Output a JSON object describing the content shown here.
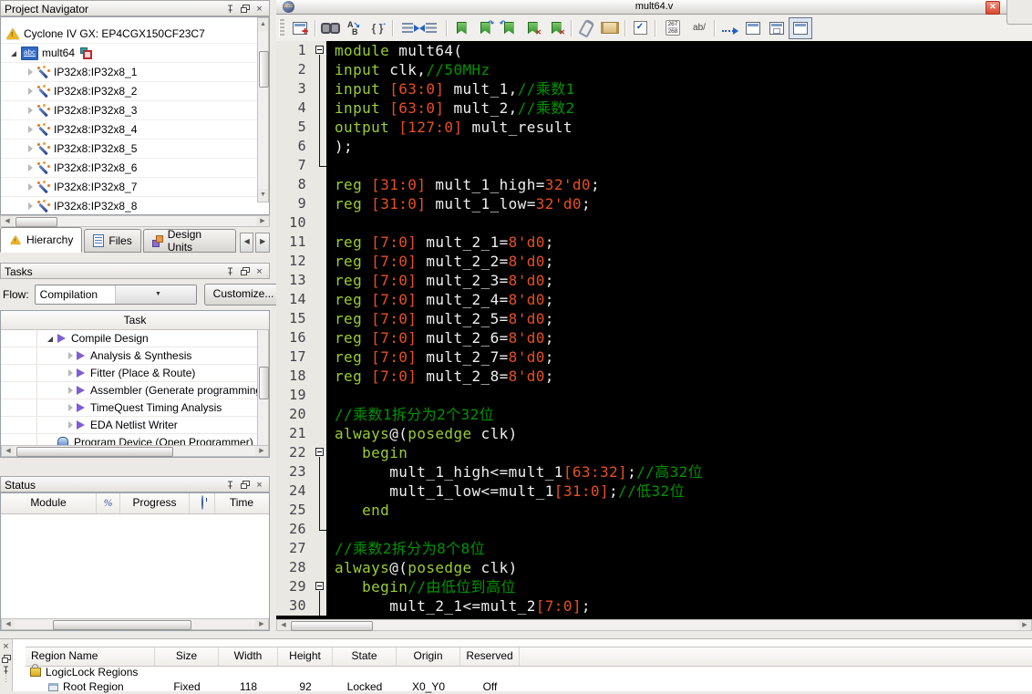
{
  "navigator": {
    "title": "Project Navigator",
    "device": "Cyclone IV GX: EP4CGX150CF23C7",
    "top_module": "mult64",
    "instances": [
      "IP32x8:IP32x8_1",
      "IP32x8:IP32x8_2",
      "IP32x8:IP32x8_3",
      "IP32x8:IP32x8_4",
      "IP32x8:IP32x8_5",
      "IP32x8:IP32x8_6",
      "IP32x8:IP32x8_7",
      "IP32x8:IP32x8_8"
    ],
    "tabs": [
      {
        "label": "Hierarchy"
      },
      {
        "label": "Files"
      },
      {
        "label": "Design Units"
      }
    ]
  },
  "tasks": {
    "title": "Tasks",
    "flow_label": "Flow:",
    "flow_value": "Compilation",
    "customize_label": "Customize...",
    "column_header": "Task",
    "items": [
      {
        "label": "Compile Design",
        "depth": 1,
        "icon": "play",
        "arrow": "expanded"
      },
      {
        "label": "Analysis & Synthesis",
        "depth": 2,
        "icon": "play",
        "arrow": "collapsed"
      },
      {
        "label": "Fitter (Place & Route)",
        "depth": 2,
        "icon": "play",
        "arrow": "collapsed"
      },
      {
        "label": "Assembler (Generate programming f",
        "depth": 2,
        "icon": "play",
        "arrow": "collapsed"
      },
      {
        "label": "TimeQuest Timing Analysis",
        "depth": 2,
        "icon": "play",
        "arrow": "collapsed"
      },
      {
        "label": "EDA Netlist Writer",
        "depth": 2,
        "icon": "play",
        "arrow": "collapsed"
      },
      {
        "label": "Program Device (Open Programmer)",
        "depth": 1,
        "icon": "hand",
        "arrow": "none"
      }
    ]
  },
  "status": {
    "title": "Status",
    "columns": [
      "Module",
      "%",
      "Progress",
      "Time"
    ]
  },
  "editor": {
    "title": "mult64.v",
    "toolbar": {
      "counter_top": "267",
      "counter_bottom": "268",
      "ab_label": "ab/"
    },
    "colors": {
      "keyword": "#9acd32",
      "number": "#e8501e",
      "comment": "#009400",
      "text": "#efefef",
      "background": "#000000"
    },
    "lines": [
      {
        "fold": "open",
        "segs": [
          [
            "k",
            "module"
          ],
          [
            "d",
            " mult64("
          ]
        ]
      },
      {
        "fold": "v",
        "segs": [
          [
            "k",
            "input"
          ],
          [
            "d",
            " clk,"
          ],
          [
            "c",
            "//50MHz"
          ]
        ]
      },
      {
        "fold": "v",
        "segs": [
          [
            "k",
            "input"
          ],
          [
            "d",
            " "
          ],
          [
            "n",
            "[63:0]"
          ],
          [
            "d",
            " mult_1,"
          ],
          [
            "c",
            "//乘数1"
          ]
        ]
      },
      {
        "fold": "v",
        "segs": [
          [
            "k",
            "input"
          ],
          [
            "d",
            " "
          ],
          [
            "n",
            "[63:0]"
          ],
          [
            "d",
            " mult_2,"
          ],
          [
            "c",
            "//乘数2"
          ]
        ]
      },
      {
        "fold": "v",
        "segs": [
          [
            "k",
            "output"
          ],
          [
            "d",
            " "
          ],
          [
            "n",
            "[127:0]"
          ],
          [
            "d",
            " mult_result"
          ]
        ]
      },
      {
        "fold": "v",
        "segs": [
          [
            "d",
            ");"
          ]
        ]
      },
      {
        "fold": "L",
        "segs": []
      },
      {
        "fold": "",
        "segs": [
          [
            "k",
            "reg"
          ],
          [
            "d",
            " "
          ],
          [
            "n",
            "[31:0]"
          ],
          [
            "d",
            " mult_1_high="
          ],
          [
            "n",
            "32'd0"
          ],
          [
            "d",
            ";"
          ]
        ]
      },
      {
        "fold": "",
        "segs": [
          [
            "k",
            "reg"
          ],
          [
            "d",
            " "
          ],
          [
            "n",
            "[31:0]"
          ],
          [
            "d",
            " mult_1_low="
          ],
          [
            "n",
            "32'd0"
          ],
          [
            "d",
            ";"
          ]
        ]
      },
      {
        "fold": "",
        "segs": []
      },
      {
        "fold": "",
        "segs": [
          [
            "k",
            "reg"
          ],
          [
            "d",
            " "
          ],
          [
            "n",
            "[7:0]"
          ],
          [
            "d",
            " mult_2_1="
          ],
          [
            "n",
            "8'd0"
          ],
          [
            "d",
            ";"
          ]
        ]
      },
      {
        "fold": "",
        "segs": [
          [
            "k",
            "reg"
          ],
          [
            "d",
            " "
          ],
          [
            "n",
            "[7:0]"
          ],
          [
            "d",
            " mult_2_2="
          ],
          [
            "n",
            "8'd0"
          ],
          [
            "d",
            ";"
          ]
        ]
      },
      {
        "fold": "",
        "segs": [
          [
            "k",
            "reg"
          ],
          [
            "d",
            " "
          ],
          [
            "n",
            "[7:0]"
          ],
          [
            "d",
            " mult_2_3="
          ],
          [
            "n",
            "8'd0"
          ],
          [
            "d",
            ";"
          ]
        ]
      },
      {
        "fold": "",
        "segs": [
          [
            "k",
            "reg"
          ],
          [
            "d",
            " "
          ],
          [
            "n",
            "[7:0]"
          ],
          [
            "d",
            " mult_2_4="
          ],
          [
            "n",
            "8'd0"
          ],
          [
            "d",
            ";"
          ]
        ]
      },
      {
        "fold": "",
        "segs": [
          [
            "k",
            "reg"
          ],
          [
            "d",
            " "
          ],
          [
            "n",
            "[7:0]"
          ],
          [
            "d",
            " mult_2_5="
          ],
          [
            "n",
            "8'd0"
          ],
          [
            "d",
            ";"
          ]
        ]
      },
      {
        "fold": "",
        "segs": [
          [
            "k",
            "reg"
          ],
          [
            "d",
            " "
          ],
          [
            "n",
            "[7:0]"
          ],
          [
            "d",
            " mult_2_6="
          ],
          [
            "n",
            "8'd0"
          ],
          [
            "d",
            ";"
          ]
        ]
      },
      {
        "fold": "",
        "segs": [
          [
            "k",
            "reg"
          ],
          [
            "d",
            " "
          ],
          [
            "n",
            "[7:0]"
          ],
          [
            "d",
            " mult_2_7="
          ],
          [
            "n",
            "8'd0"
          ],
          [
            "d",
            ";"
          ]
        ]
      },
      {
        "fold": "",
        "segs": [
          [
            "k",
            "reg"
          ],
          [
            "d",
            " "
          ],
          [
            "n",
            "[7:0]"
          ],
          [
            "d",
            " mult_2_8="
          ],
          [
            "n",
            "8'd0"
          ],
          [
            "d",
            ";"
          ]
        ]
      },
      {
        "fold": "",
        "segs": []
      },
      {
        "fold": "",
        "segs": [
          [
            "c",
            "//乘数1拆分为2个32位"
          ]
        ]
      },
      {
        "fold": "",
        "segs": [
          [
            "k",
            "always"
          ],
          [
            "d",
            "@("
          ],
          [
            "k",
            "posedge"
          ],
          [
            "d",
            " clk)"
          ]
        ]
      },
      {
        "fold": "open",
        "segs": [
          [
            "d",
            "   "
          ],
          [
            "k",
            "begin"
          ]
        ]
      },
      {
        "fold": "v",
        "segs": [
          [
            "d",
            "      mult_1_high<=mult_1"
          ],
          [
            "n",
            "[63:32]"
          ],
          [
            "d",
            ";"
          ],
          [
            "c",
            "//高32位"
          ]
        ]
      },
      {
        "fold": "v",
        "segs": [
          [
            "d",
            "      mult_1_low<=mult_1"
          ],
          [
            "n",
            "[31:0]"
          ],
          [
            "d",
            ";"
          ],
          [
            "c",
            "//低32位"
          ]
        ]
      },
      {
        "fold": "v",
        "segs": [
          [
            "d",
            "   "
          ],
          [
            "k",
            "end"
          ]
        ]
      },
      {
        "fold": "L",
        "segs": []
      },
      {
        "fold": "",
        "segs": [
          [
            "c",
            "//乘数2拆分为8个8位"
          ]
        ]
      },
      {
        "fold": "",
        "segs": [
          [
            "k",
            "always"
          ],
          [
            "d",
            "@("
          ],
          [
            "k",
            "posedge"
          ],
          [
            "d",
            " clk)"
          ]
        ]
      },
      {
        "fold": "open",
        "segs": [
          [
            "d",
            "   "
          ],
          [
            "k",
            "begin"
          ],
          [
            "c",
            "//由低位到高位"
          ]
        ]
      },
      {
        "fold": "v",
        "segs": [
          [
            "d",
            "      mult_2_1<=mult_2"
          ],
          [
            "n",
            "[7:0]"
          ],
          [
            "d",
            ";"
          ]
        ]
      }
    ]
  },
  "regions": {
    "columns": [
      "Region Name",
      "Size",
      "Width",
      "Height",
      "State",
      "Origin",
      "Reserved"
    ],
    "rows": [
      {
        "icon": "lock",
        "indent": 1,
        "name": "LogicLock Regions",
        "size": "",
        "width": "",
        "height": "",
        "state": "",
        "origin": "",
        "reserved": ""
      },
      {
        "icon": "region",
        "indent": 2,
        "name": "Root Region",
        "size": "Fixed",
        "width": "118",
        "height": "92",
        "state": "Locked",
        "origin": "X0_Y0",
        "reserved": "Off"
      }
    ]
  }
}
